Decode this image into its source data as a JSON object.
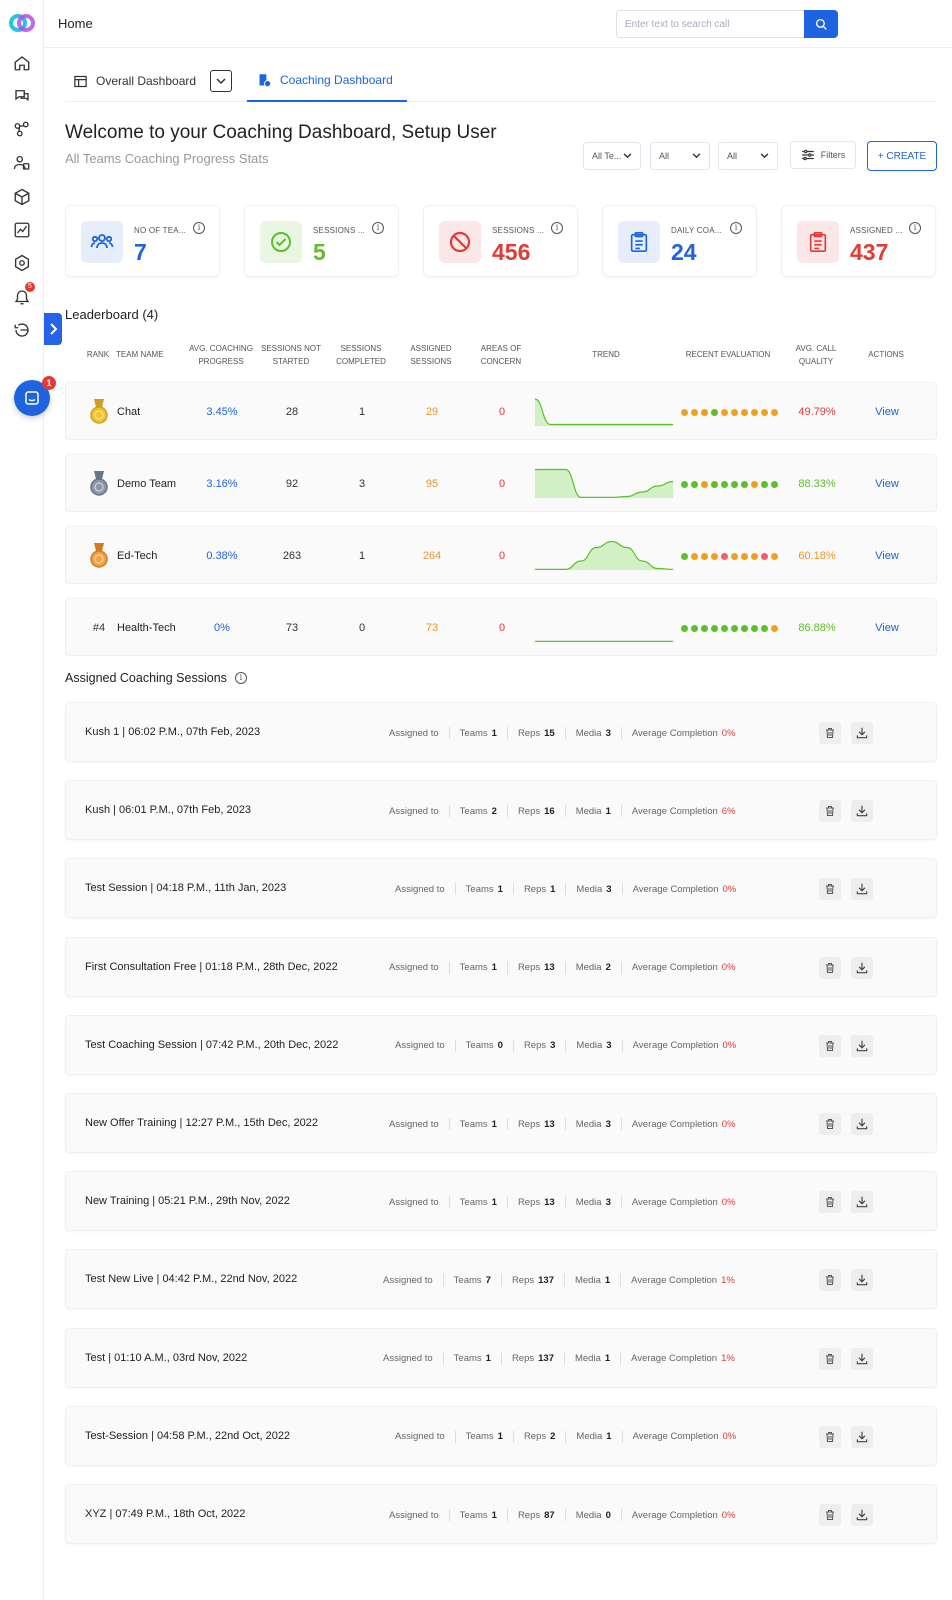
{
  "header": {
    "title": "Home",
    "search_placeholder": "Enter text to search call"
  },
  "tabs": [
    {
      "label": "Overall Dashboard"
    },
    {
      "label": "Coaching Dashboard"
    }
  ],
  "welcome": "Welcome to your Coaching Dashboard, Setup User",
  "subtitle": "All Teams Coaching Progress Stats",
  "filters": {
    "team": "All Te...",
    "f2": "All",
    "f3": "All",
    "filters_label": "Filters",
    "create_label": "+ CREATE"
  },
  "colors": {
    "primary": "#1e63e0",
    "red": "#e53935",
    "green": "#5cbf2a",
    "orange": "#f0932b"
  },
  "sidebar": {
    "notification_badge": "5",
    "chat_badge": "1"
  },
  "stats": [
    {
      "label": "NO OF TEA...",
      "value": "7",
      "color": "#1e63e0",
      "icon": "team-icon"
    },
    {
      "label": "SESSIONS ...",
      "value": "5",
      "color": "#5cbf2a",
      "icon": "check-circle-icon"
    },
    {
      "label": "SESSIONS ...",
      "value": "456",
      "color": "#e53935",
      "icon": "block-icon"
    },
    {
      "label": "DAILY COA...",
      "value": "24",
      "color": "#1e63e0",
      "icon": "clipboard-icon"
    },
    {
      "label": "ASSIGNED ...",
      "value": "437",
      "color": "#e53935",
      "icon": "clipboard-icon"
    }
  ],
  "leaderboard": {
    "title": "Leaderboard (4)",
    "headers": [
      "RANK",
      "TEAM NAME",
      "AVG. COACHING PROGRESS",
      "SESSIONS NOT STARTED",
      "SESSIONS COMPLETED",
      "ASSIGNED SESSIONS",
      "AREAS OF CONCERN",
      "TREND",
      "RECENT EVALUATION",
      "AVG. CALL QUALITY",
      "ACTIONS"
    ],
    "rows": [
      {
        "rank": "",
        "medal": "gold",
        "team": "Chat",
        "progress": "3.45%",
        "not_started": "28",
        "completed": "1",
        "assigned": "29",
        "concern": "0",
        "trend": [
          0.9,
          0.05,
          0.05,
          0.05,
          0.05,
          0.05,
          0.05,
          0.05,
          0.05,
          0.05
        ],
        "evaluation": [
          "o",
          "o",
          "o",
          "g",
          "o",
          "o",
          "o",
          "o",
          "o",
          "o"
        ],
        "quality": "49.79%",
        "quality_color": "#e53935",
        "action": "View"
      },
      {
        "rank": "",
        "medal": "silver",
        "team": "Demo Team",
        "progress": "3.16%",
        "not_started": "92",
        "completed": "3",
        "assigned": "95",
        "concern": "0",
        "trend": [
          0.95,
          0.95,
          0.95,
          0.02,
          0.02,
          0.02,
          0.05,
          0.2,
          0.4,
          0.55
        ],
        "evaluation": [
          "g",
          "g",
          "o",
          "g",
          "g",
          "g",
          "g",
          "o",
          "g",
          "g"
        ],
        "quality": "88.33%",
        "quality_color": "#5cbf2a",
        "action": "View"
      },
      {
        "rank": "",
        "medal": "bronze",
        "team": "Ed-Tech",
        "progress": "0.38%",
        "not_started": "263",
        "completed": "1",
        "assigned": "264",
        "concern": "0",
        "trend": [
          0.02,
          0.02,
          0.02,
          0.3,
          0.75,
          0.95,
          0.75,
          0.3,
          0.05,
          0.02
        ],
        "evaluation": [
          "g",
          "o",
          "o",
          "o",
          "r",
          "o",
          "o",
          "o",
          "r",
          "o"
        ],
        "quality": "60.18%",
        "quality_color": "#f0932b",
        "action": "View"
      },
      {
        "rank": "#4",
        "medal": "",
        "team": "Health-Tech",
        "progress": "0%",
        "not_started": "73",
        "completed": "0",
        "assigned": "73",
        "concern": "0",
        "trend": [
          0.02,
          0.02,
          0.02,
          0.02,
          0.02,
          0.02,
          0.02,
          0.02,
          0.02,
          0.02
        ],
        "evaluation": [
          "g",
          "g",
          "g",
          "g",
          "g",
          "g",
          "g",
          "g",
          "g",
          "o"
        ],
        "quality": "86.88%",
        "quality_color": "#5cbf2a",
        "action": "View"
      }
    ]
  },
  "sessions_title": "Assigned Coaching Sessions",
  "sessions": [
    {
      "name": "Kush 1 | 06:02 P.M., 07th Feb, 2023",
      "assigned": "Assigned to",
      "teams": "1",
      "reps": "15",
      "media": "3",
      "completion": "0%"
    },
    {
      "name": "Kush | 06:01 P.M., 07th Feb, 2023",
      "assigned": "Assigned to",
      "teams": "2",
      "reps": "16",
      "media": "1",
      "completion": "6%"
    },
    {
      "name": "Test Session | 04:18 P.M., 11th Jan, 2023",
      "assigned": "Assigned to",
      "teams": "1",
      "reps": "1",
      "media": "3",
      "completion": "0%"
    },
    {
      "name": "First Consultation Free | 01:18 P.M., 28th Dec, 2022",
      "assigned": "Assigned to",
      "teams": "1",
      "reps": "13",
      "media": "2",
      "completion": "0%"
    },
    {
      "name": "Test Coaching Session | 07:42 P.M., 20th Dec, 2022",
      "assigned": "Assigned to",
      "teams": "0",
      "reps": "3",
      "media": "3",
      "completion": "0%"
    },
    {
      "name": "New Offer Training | 12:27 P.M., 15th Dec, 2022",
      "assigned": "Assigned to",
      "teams": "1",
      "reps": "13",
      "media": "3",
      "completion": "0%"
    },
    {
      "name": "New Training | 05:21 P.M., 29th Nov, 2022",
      "assigned": "Assigned to",
      "teams": "1",
      "reps": "13",
      "media": "3",
      "completion": "0%"
    },
    {
      "name": "Test New Live | 04:42 P.M., 22nd Nov, 2022",
      "assigned": "Assigned to",
      "teams": "7",
      "reps": "137",
      "media": "1",
      "completion": "1%"
    },
    {
      "name": "Test | 01:10 A.M., 03rd Nov, 2022",
      "assigned": "Assigned to",
      "teams": "1",
      "reps": "137",
      "media": "1",
      "completion": "1%"
    },
    {
      "name": "Test-Session | 04:58 P.M., 22nd Oct, 2022",
      "assigned": "Assigned to",
      "teams": "1",
      "reps": "2",
      "media": "1",
      "completion": "0%"
    },
    {
      "name": "XYZ | 07:49 P.M., 18th Oct, 2022",
      "assigned": "Assigned to",
      "teams": "1",
      "reps": "87",
      "media": "0",
      "completion": "0%"
    }
  ],
  "labels": {
    "teams": "Teams",
    "reps": "Reps",
    "media": "Media",
    "avg_completion": "Average Completion"
  }
}
